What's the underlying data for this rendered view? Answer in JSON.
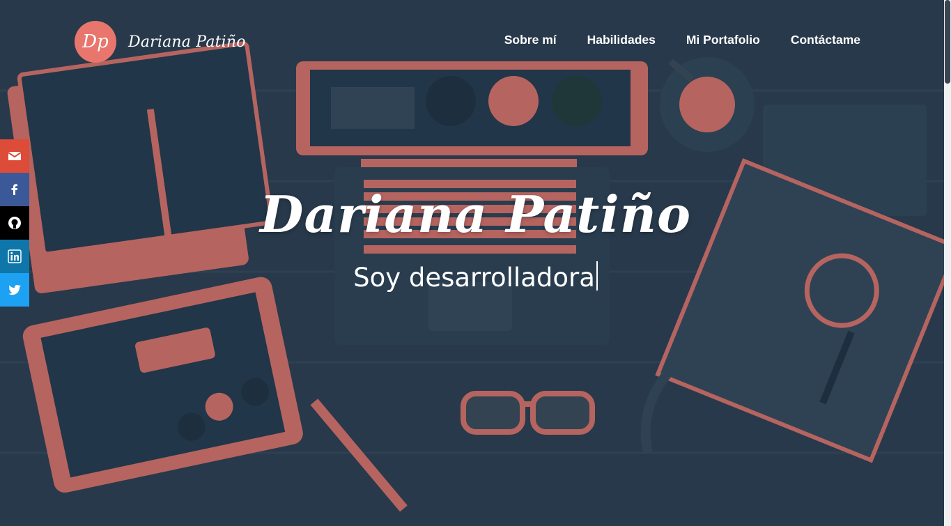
{
  "brand": {
    "logo_text": "Dp",
    "name": "Dariana Patiño"
  },
  "nav": [
    {
      "label": "Sobre mí"
    },
    {
      "label": "Habilidades"
    },
    {
      "label": "Mi Portafolio"
    },
    {
      "label": "Contáctame"
    }
  ],
  "social": [
    {
      "icon": "email-icon",
      "color": "#dd4b39"
    },
    {
      "icon": "facebook-icon",
      "color": "#3b5998"
    },
    {
      "icon": "github-icon",
      "color": "#000000"
    },
    {
      "icon": "linkedin-icon",
      "color": "#0e76a8"
    },
    {
      "icon": "twitter-icon",
      "color": "#1da1f2"
    }
  ],
  "hero": {
    "title": "Dariana Patiño",
    "subtitle": "Soy desarrolladora"
  },
  "colors": {
    "background": "#2b3d50",
    "accent": "#e8766c"
  }
}
